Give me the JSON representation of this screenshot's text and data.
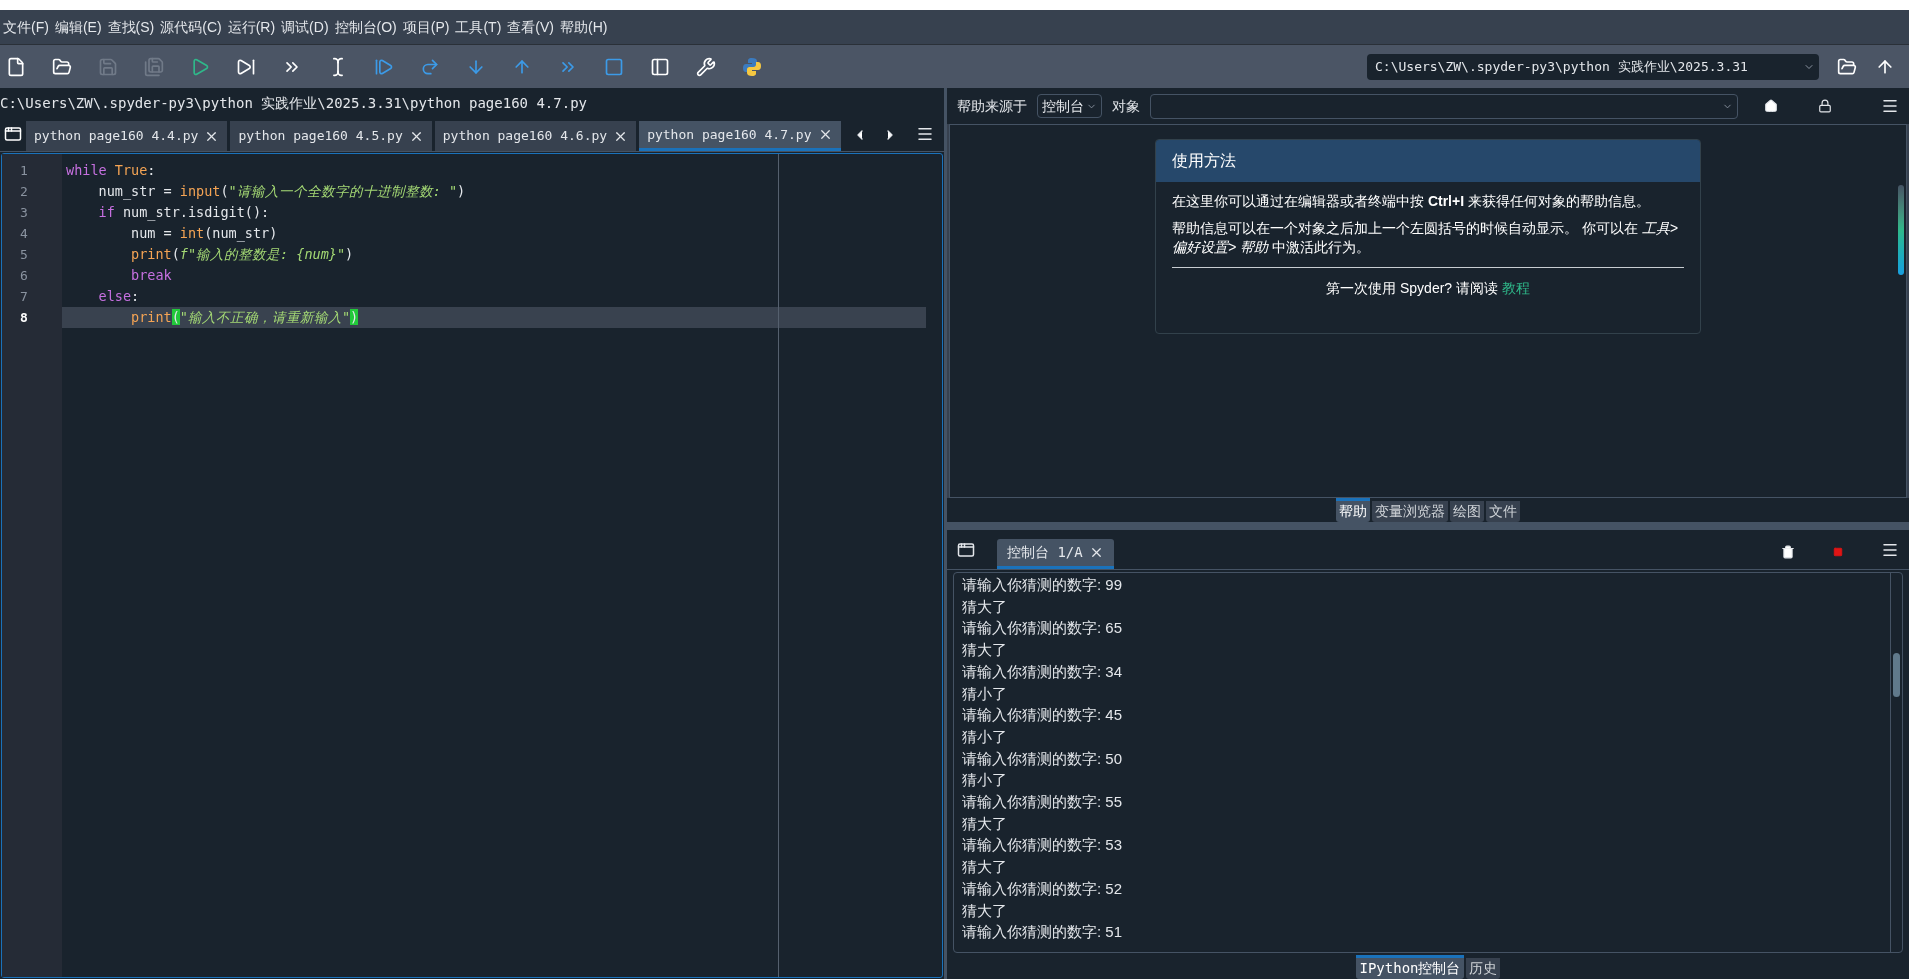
{
  "menu": [
    "文件(F)",
    "编辑(E)",
    "查找(S)",
    "源代码(C)",
    "运行(R)",
    "调试(D)",
    "控制台(O)",
    "项目(P)",
    "工具(T)",
    "查看(V)",
    "帮助(H)"
  ],
  "toolbar": [
    {
      "kind": "new-file",
      "disabled": false
    },
    {
      "kind": "open",
      "disabled": false
    },
    {
      "kind": "save",
      "disabled": true
    },
    {
      "kind": "save-all",
      "disabled": true
    },
    {
      "kind": "run",
      "disabled": false
    },
    {
      "kind": "run-cell",
      "disabled": false
    },
    {
      "kind": "run-cell-advance",
      "disabled": false
    },
    {
      "kind": "run-selection",
      "disabled": false
    },
    {
      "kind": "debug",
      "disabled": false
    },
    {
      "kind": "step",
      "disabled": false
    },
    {
      "kind": "step-into",
      "disabled": false
    },
    {
      "kind": "step-out",
      "disabled": false
    },
    {
      "kind": "continue",
      "disabled": false
    },
    {
      "kind": "stop",
      "disabled": false
    },
    {
      "kind": "maximize",
      "disabled": false
    },
    {
      "kind": "preferences",
      "disabled": false
    },
    {
      "kind": "python",
      "disabled": false
    }
  ],
  "working_directory": "C:\\Users\\ZW\\.spyder-py3\\python 实践作业\\2025.3.31",
  "editor": {
    "path": "C:\\Users\\ZW\\.spyder-py3\\python 实践作业\\2025.3.31\\python page160 4.7.py",
    "tabs": [
      {
        "label": "python page160 4.4.py",
        "selected": false
      },
      {
        "label": "python page160 4.5.py",
        "selected": false
      },
      {
        "label": "python page160 4.6.py",
        "selected": false
      },
      {
        "label": "python page160 4.7.py",
        "selected": true
      }
    ],
    "lines": [
      {
        "number": "1",
        "current": false,
        "tokens": [
          {
            "kind": "keyword",
            "text": "while "
          },
          {
            "kind": "constant",
            "text": "True"
          },
          {
            "kind": "plain",
            "text": ":"
          }
        ]
      },
      {
        "number": "2",
        "current": false,
        "tokens": [
          {
            "kind": "plain",
            "text": "    num_str = "
          },
          {
            "kind": "builtin",
            "text": "input"
          },
          {
            "kind": "plain",
            "text": "("
          },
          {
            "kind": "string",
            "text": "\"请输入一个全数字的十进制整数: \""
          },
          {
            "kind": "plain",
            "text": ")"
          }
        ]
      },
      {
        "number": "3",
        "current": false,
        "tokens": [
          {
            "kind": "keyword",
            "text": "    if"
          },
          {
            "kind": "plain",
            "text": " num_str.isdigit():"
          }
        ]
      },
      {
        "number": "4",
        "current": false,
        "tokens": [
          {
            "kind": "plain",
            "text": "        num = "
          },
          {
            "kind": "builtin",
            "text": "int"
          },
          {
            "kind": "plain",
            "text": "(num_str)"
          }
        ]
      },
      {
        "number": "5",
        "current": false,
        "tokens": [
          {
            "kind": "builtin",
            "text": "        print"
          },
          {
            "kind": "plain",
            "text": "("
          },
          {
            "kind": "string",
            "text": "f\"输入的整数是: {num}\""
          },
          {
            "kind": "plain",
            "text": ")"
          }
        ]
      },
      {
        "number": "6",
        "current": false,
        "tokens": [
          {
            "kind": "keyword",
            "text": "        break"
          }
        ]
      },
      {
        "number": "7",
        "current": false,
        "tokens": [
          {
            "kind": "keyword",
            "text": "    else"
          },
          {
            "kind": "plain",
            "text": ":"
          }
        ]
      },
      {
        "number": "8",
        "current": true,
        "tokens": [
          {
            "kind": "builtin",
            "text": "        print"
          },
          {
            "kind": "match",
            "text": "("
          },
          {
            "kind": "string",
            "text": "\"输入不正确，请重新输入\""
          },
          {
            "kind": "match",
            "text": ")"
          }
        ]
      }
    ]
  },
  "help": {
    "source_label": "帮助来源于",
    "source": "控制台",
    "object_label": "对象",
    "card": {
      "title": "使用方法",
      "paragraphs": [
        "在这里你可以通过在编辑器或者终端中按 **Ctrl+I** 来获得任何对象的帮助信息。",
        "帮助信息可以在一个对象之后加上一个左圆括号的时候自动显示。 你可以在 *工具> 偏好设置> 帮助* 中激活此行为。"
      ],
      "footer": "第一次使用 Spyder? 请阅读",
      "link": "教程"
    },
    "tabs": [
      {
        "label": "帮助",
        "selected": true
      },
      {
        "label": "变量浏览器",
        "selected": false
      },
      {
        "label": "绘图",
        "selected": false
      },
      {
        "label": "文件",
        "selected": false
      }
    ]
  },
  "console": {
    "tab": "控制台 1/A",
    "lines": [
      "请输入你猜测的数字: 99",
      "猜大了",
      "请输入你猜测的数字: 65",
      "猜大了",
      "请输入你猜测的数字: 34",
      "猜小了",
      "请输入你猜测的数字: 45",
      "猜小了",
      "请输入你猜测的数字: 50",
      "猜小了",
      "请输入你猜测的数字: 55",
      "猜大了",
      "请输入你猜测的数字: 53",
      "猜大了",
      "请输入你猜测的数字: 52",
      "猜大了",
      "请输入你猜测的数字: 51"
    ],
    "tabs": [
      {
        "label": "IPython控制台",
        "selected": true
      },
      {
        "label": "历史",
        "selected": false
      }
    ]
  }
}
